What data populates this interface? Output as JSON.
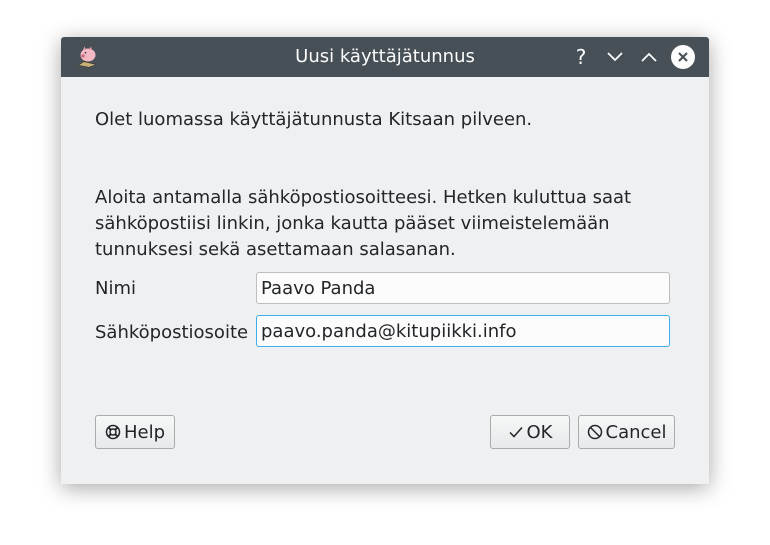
{
  "window": {
    "title": "Uusi käyttäjätunnus",
    "controls": {
      "help": "?"
    }
  },
  "content": {
    "intro": "Olet luomassa käyttäjätunnusta Kitsaan pilveen.",
    "instructions_lines": [
      "Aloita antamalla sähköpostiosoitteesi. Hetken kuluttua saat",
      "sähköpostiisi linkin, jonka kautta pääset viimeistelemään",
      "tunnuksesi sekä asettamaan salasanan."
    ]
  },
  "form": {
    "name_label": "Nimi",
    "name_value": "Paavo Panda",
    "email_label": "Sähköpostiosoite",
    "email_value": "paavo.panda@kitupiikki.info"
  },
  "buttons": {
    "help": "Help",
    "ok": "OK",
    "cancel": "Cancel"
  },
  "icons": {
    "app": "pig-app-icon",
    "help": "lifebuoy-icon",
    "ok": "checkmark-icon",
    "cancel": "cancel-circle-icon"
  },
  "colors": {
    "titlebar": "#475057",
    "window_bg": "#eff0f1",
    "focus": "#3daee9"
  }
}
